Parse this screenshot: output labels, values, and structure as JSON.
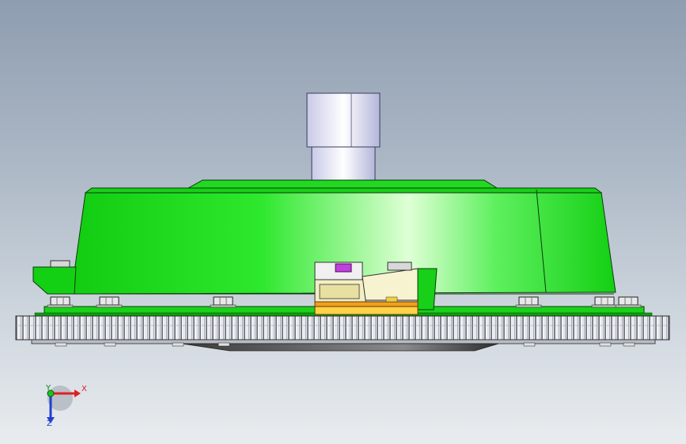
{
  "viewport": {
    "background_top": "#8e9db0",
    "background_bottom": "#e9ecef"
  },
  "model": {
    "housing_color": "#1fe21f",
    "housing_highlight": "#dfffd6",
    "shaft_color": "#e6e8f4",
    "gear_color": "#d9dde3",
    "bracket_color": "#f2e9b0",
    "accent_magenta": "#c040e0",
    "accent_orange": "#f0a020"
  },
  "triad": {
    "icon": "coordinate-triad-icon",
    "x_label": "X",
    "y_label": "Y",
    "z_label": "Z",
    "x_color": "#e02020",
    "y_color": "#20c020",
    "z_color": "#2040d0"
  }
}
